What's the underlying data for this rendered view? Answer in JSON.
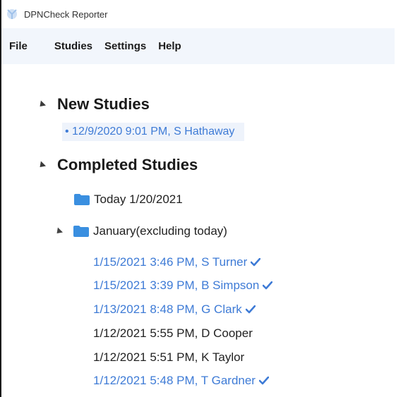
{
  "window": {
    "title": "DPNCheck Reporter"
  },
  "menu": {
    "file": "File",
    "studies": "Studies",
    "settings": "Settings",
    "help": "Help"
  },
  "tree": {
    "new_studies": {
      "label": "New Studies",
      "items": [
        "• 12/9/2020 9:01 PM, S Hathaway"
      ]
    },
    "completed_studies": {
      "label": "Completed Studies",
      "folders": {
        "today": "Today 1/20/2021",
        "january": "January(excluding today)"
      },
      "january_items": [
        {
          "text": "1/15/2021 3:46 PM, S Turner",
          "checked": true
        },
        {
          "text": "1/15/2021 3:39 PM, B Simpson",
          "checked": true
        },
        {
          "text": "1/13/2021 8:48 PM, G Clark",
          "checked": true
        },
        {
          "text": "1/12/2021 5:55 PM, D Cooper",
          "checked": false
        },
        {
          "text": "1/12/2021 5:51 PM, K Taylor",
          "checked": false
        },
        {
          "text": "1/12/2021 5:48 PM, T Gardner",
          "checked": true
        }
      ]
    }
  },
  "colors": {
    "link": "#3e7bd6",
    "folder": "#3a8fe0",
    "menubar_bg": "#f2f6fc"
  },
  "icons": {
    "app": "app-logo-icon",
    "toggle": "expand-triangle-icon",
    "folder": "folder-icon",
    "check": "checkmark-icon"
  }
}
